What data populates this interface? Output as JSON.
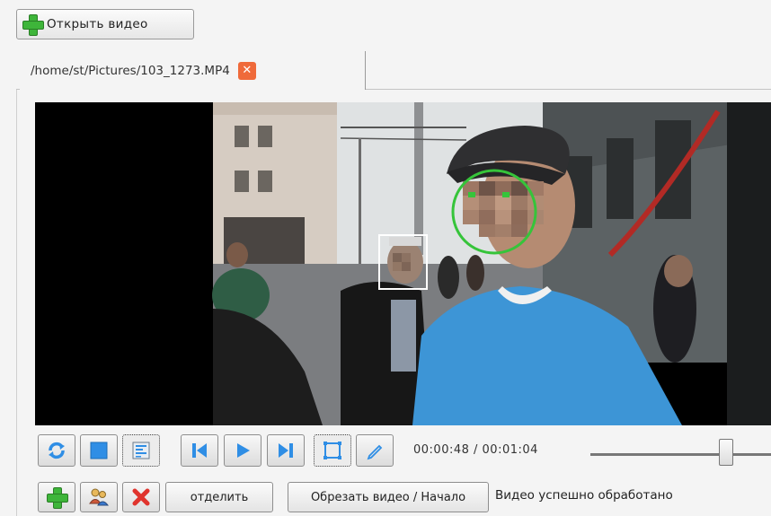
{
  "toolbar": {
    "open_video_label": "Открыть видео"
  },
  "tab": {
    "file_path": "/home/st/Pictures/103_1273.MP4",
    "close_symbol": "✕"
  },
  "player": {
    "time_current": "00:00:48",
    "time_total": "00:01:04",
    "time_display": "00:00:48 / 00:01:04",
    "seek_position_fraction": 0.75
  },
  "actions": {
    "separate_label": "отделить",
    "trim_label": "Обрезать видео / Начало",
    "status": "Видео успешно обработано"
  },
  "colors": {
    "accent_blue": "#2f8ee5",
    "add_green": "#3eb53a",
    "delete_red": "#e0342d",
    "face_track_green": "#36c43a",
    "selection_white": "#ffffff"
  },
  "icons": {
    "open": "plus-icon",
    "refresh": "refresh-icon",
    "stop": "stop-icon",
    "settings": "list-settings-icon",
    "skip_back": "skip-back-icon",
    "play": "play-icon",
    "skip_forward": "skip-forward-icon",
    "select_rect": "select-rect-icon",
    "pencil": "pencil-icon",
    "add": "add-icon",
    "users": "users-icon",
    "delete": "delete-icon"
  }
}
